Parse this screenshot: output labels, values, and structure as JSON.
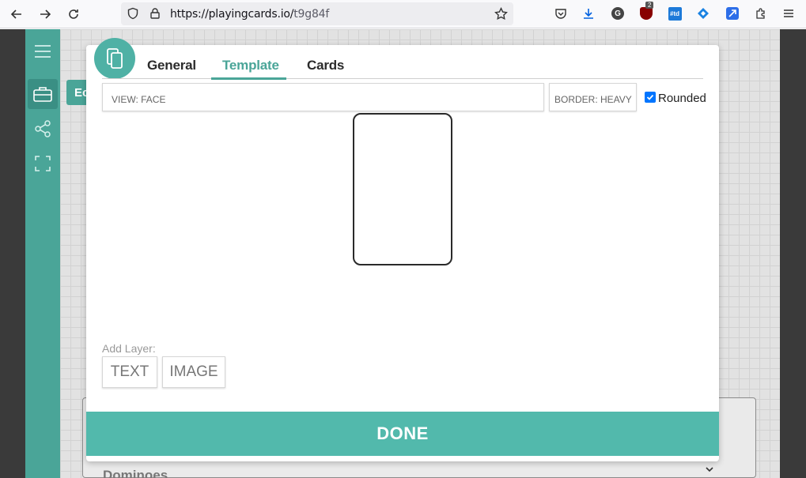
{
  "browser": {
    "url_host": "https://playingcards.io/",
    "url_path": "t9g84f",
    "extension_badge": "2",
    "td_label": "#td"
  },
  "behind": {
    "tab_label": "Ec",
    "dropdown_text": "Dominoes"
  },
  "modal": {
    "tabs": [
      {
        "label": "General"
      },
      {
        "label": "Template"
      },
      {
        "label": "Cards"
      }
    ],
    "active_tab": "Template",
    "view_select": "VIEW: FACE",
    "border_select": "BORDER: HEAVY",
    "rounded_label": "Rounded",
    "rounded_checked": true,
    "add_layer_label": "Add Layer:",
    "layer_buttons": {
      "text": "TEXT",
      "image": "IMAGE"
    },
    "done_label": "DONE"
  },
  "colors": {
    "accent": "#4aa598",
    "done": "#52b9ac",
    "checkbox": "#0075ff"
  }
}
